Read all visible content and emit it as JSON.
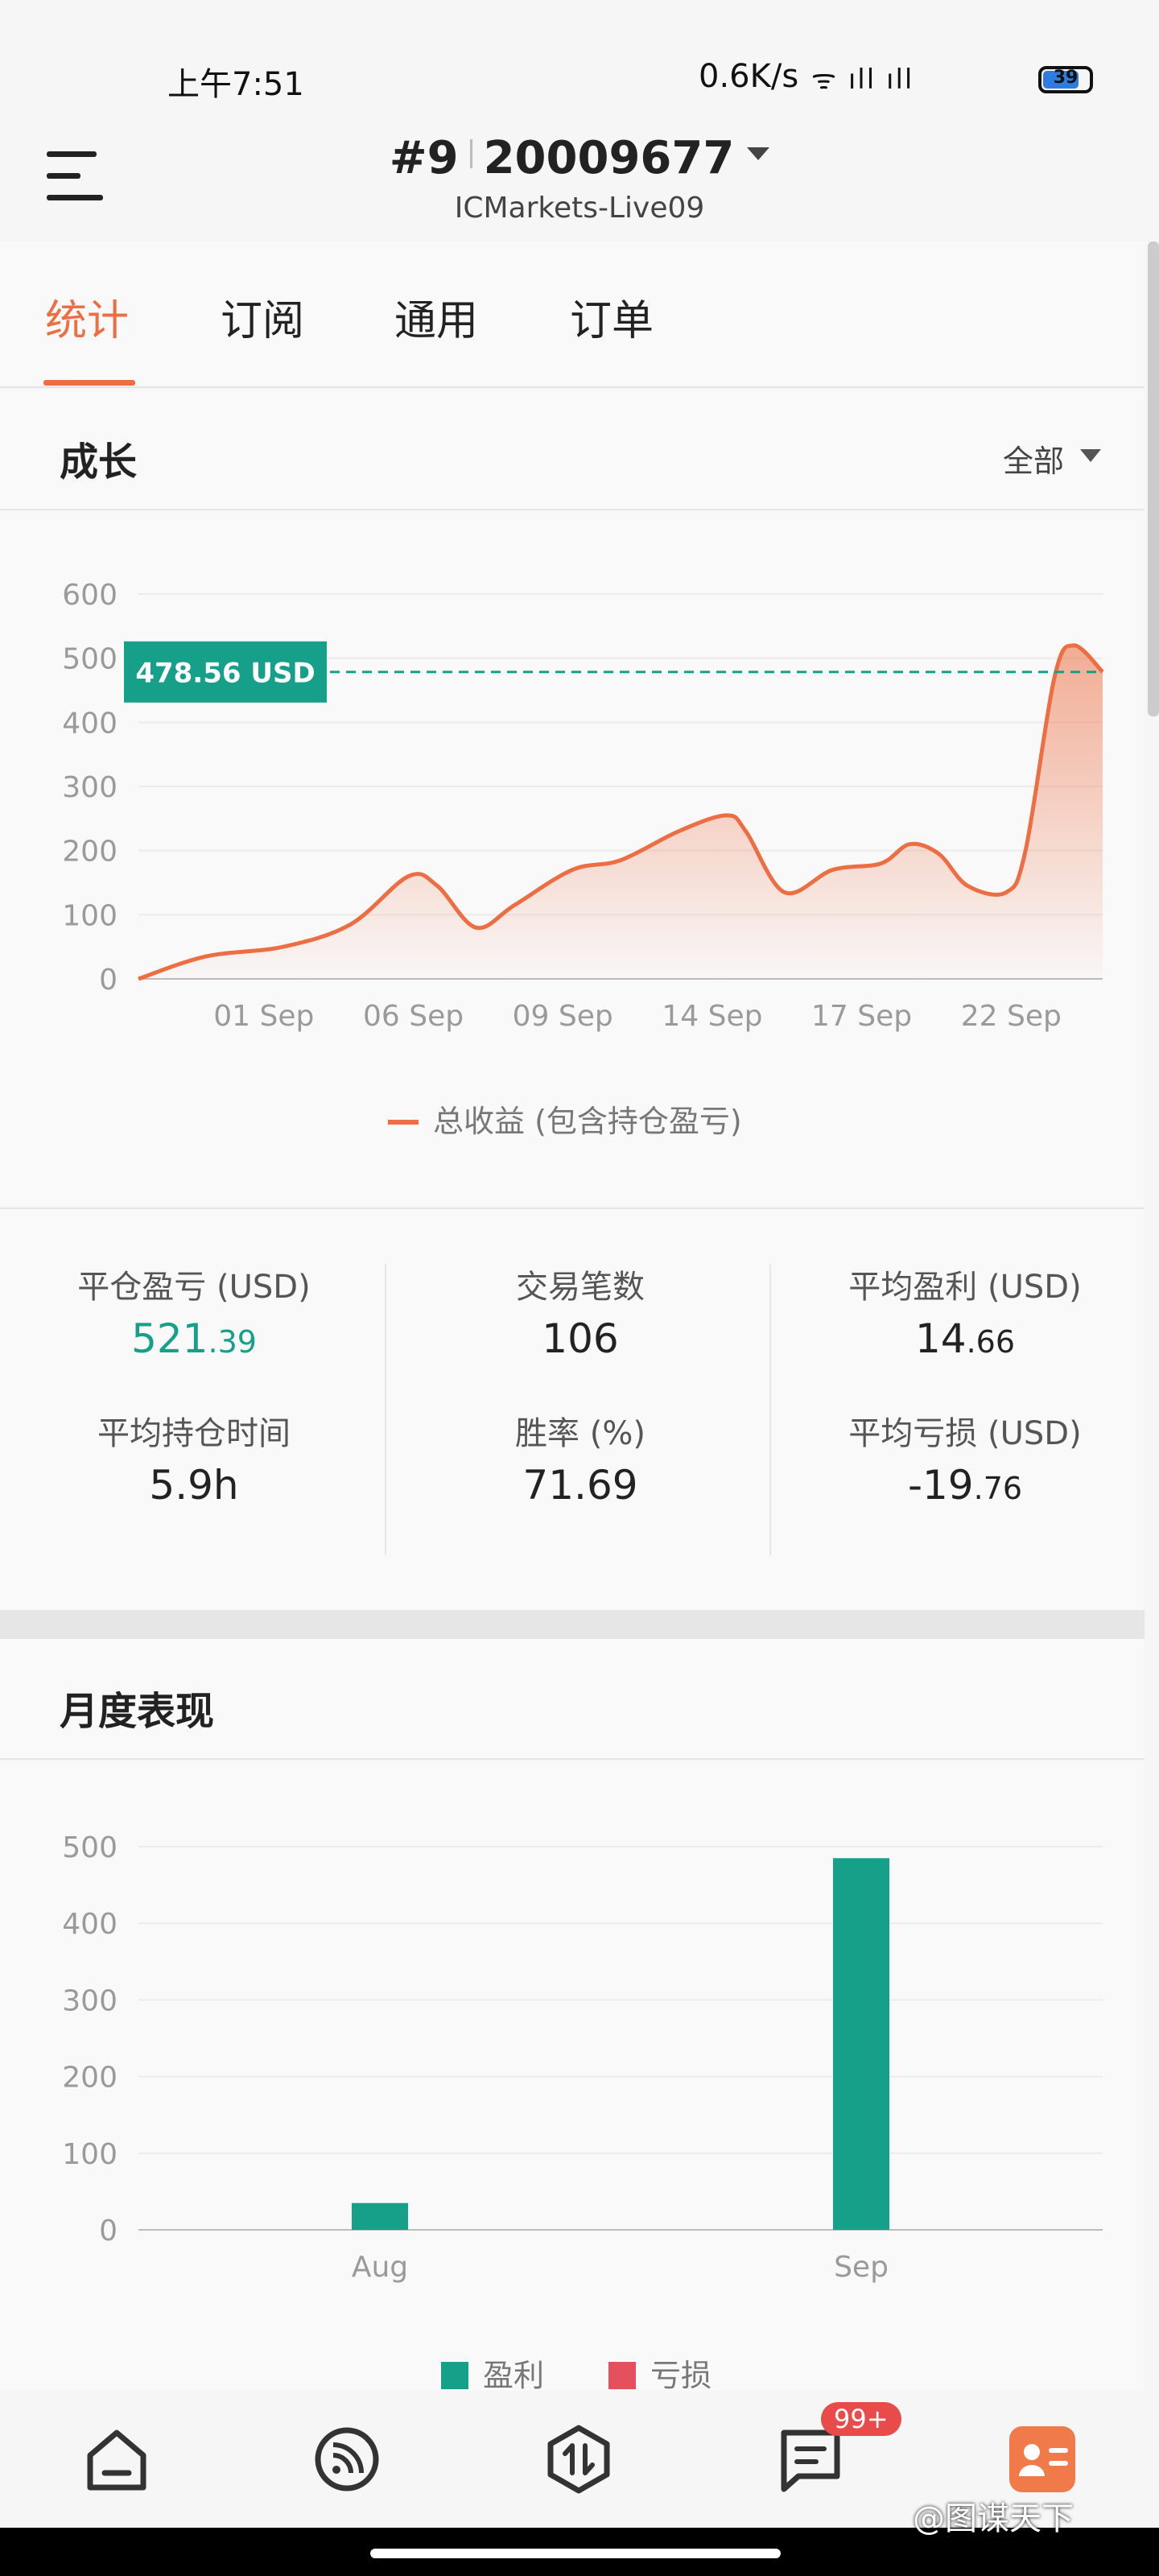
{
  "status_bar": {
    "time": "上午7:51",
    "net_speed": "0.6K/s",
    "signal_icons": "ᯤ ıll ıll",
    "battery": "39"
  },
  "header": {
    "account_index": "#9",
    "account_number": "20009677",
    "server": "ICMarkets-Live09"
  },
  "tabs": [
    {
      "label": "统计",
      "active": true
    },
    {
      "label": "订阅",
      "active": false
    },
    {
      "label": "通用",
      "active": false
    },
    {
      "label": "订单",
      "active": false
    }
  ],
  "growth": {
    "title": "成长",
    "filter_label": "全部",
    "current_value_label": "478.56 USD",
    "legend_label": "总收益 (包含持仓盈亏)",
    "accent_color": "#ec6e42",
    "marker_color": "#16a08a"
  },
  "stats": {
    "closed_pnl": {
      "label": "平仓盈亏 (USD)",
      "int": "521",
      "dec": ".39"
    },
    "trades": {
      "label": "交易笔数",
      "value": "106"
    },
    "avg_profit": {
      "label": "平均盈利 (USD)",
      "int": "14",
      "dec": ".66"
    },
    "avg_hold": {
      "label": "平均持仓时间",
      "value": "5.9h"
    },
    "win_rate": {
      "label": "胜率 (%)",
      "value": "71.69"
    },
    "avg_loss": {
      "label": "平均亏损 (USD)",
      "int": "-19",
      "dec": ".76"
    }
  },
  "monthly": {
    "title": "月度表现",
    "legend_profit": "盈利",
    "legend_loss": "亏损",
    "profit_color": "#16a08a",
    "loss_color": "#e4505e"
  },
  "bottom_nav": {
    "badge": "99+",
    "items": [
      "home-icon",
      "feed-icon",
      "trade-icon",
      "messages-icon",
      "account-icon"
    ]
  },
  "watermark": "@图谋天下",
  "chart_data": [
    {
      "type": "area",
      "title": "成长",
      "x_ticks": [
        "01 Sep",
        "06 Sep",
        "09 Sep",
        "14 Sep",
        "17 Sep",
        "22 Sep"
      ],
      "ylim": [
        0,
        600
      ],
      "y_ticks": [
        0,
        100,
        200,
        300,
        400,
        500,
        600
      ],
      "series": [
        {
          "name": "总收益 (包含持仓盈亏)",
          "x": [
            0,
            0.07,
            0.15,
            0.22,
            0.28,
            0.31,
            0.35,
            0.39,
            0.45,
            0.5,
            0.56,
            0.61,
            0.63,
            0.67,
            0.72,
            0.77,
            0.8,
            0.83,
            0.86,
            0.9,
            0.92,
            0.95,
            0.97,
            1.0
          ],
          "values": [
            0,
            35,
            50,
            85,
            160,
            145,
            80,
            115,
            170,
            185,
            230,
            255,
            230,
            135,
            170,
            180,
            210,
            195,
            145,
            135,
            200,
            470,
            520,
            478.56
          ]
        }
      ],
      "reference_value": 478.56,
      "grid": true,
      "legend": "bottom"
    },
    {
      "type": "bar",
      "title": "月度表现",
      "categories": [
        "Aug",
        "Sep"
      ],
      "ylim": [
        0,
        500
      ],
      "y_ticks": [
        0,
        100,
        200,
        300,
        400,
        500
      ],
      "series": [
        {
          "name": "盈利",
          "values": [
            35,
            485
          ]
        },
        {
          "name": "亏损",
          "values": [
            0,
            0
          ]
        }
      ],
      "grid": true,
      "legend": "bottom"
    }
  ]
}
